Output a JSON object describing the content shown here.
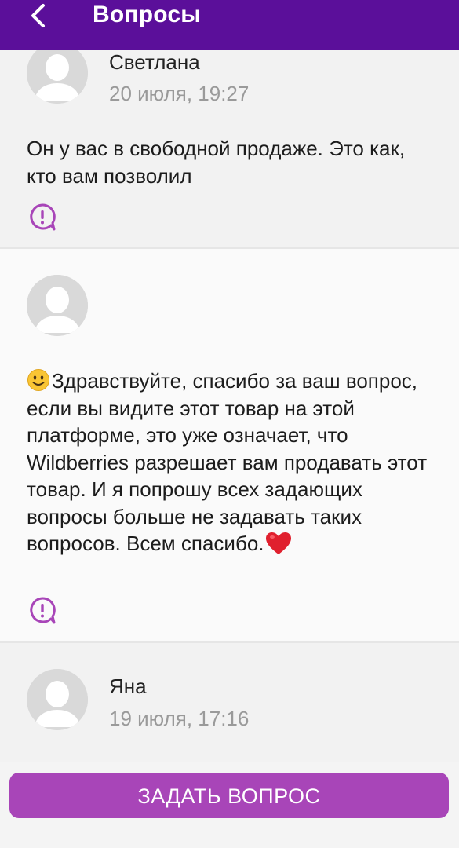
{
  "header": {
    "title": "Вопросы",
    "back_icon": "chevron-left-icon",
    "background": "#5b0f9a"
  },
  "questions": [
    {
      "author": "Светлана",
      "date": "20 июля, 19:27",
      "text": "Он у вас в свободной продаже. Это как, кто вам позволил",
      "report_icon": "report-icon"
    },
    {
      "author": "",
      "date": "",
      "text": "Здравствуйте, спасибо за ваш вопрос, если вы видите этот товар на этой платформе, это уже означает, что Wildberries разрешает вам продавать этот товар. И я попрошу всех задающих вопросы больше не задавать таких вопросов. Всем спасибо.",
      "leading_emoji": "slightly-smiling-face",
      "trailing_emoji": "red-heart",
      "report_icon": "report-icon"
    },
    {
      "author": "Яна",
      "date": "19 июля, 17:16"
    }
  ],
  "ask_button": {
    "label": "ЗАДАТЬ ВОПРОС",
    "color": "#a845b8"
  },
  "colors": {
    "accent": "#a845b8",
    "header": "#5b0f9a",
    "report_icon": "#a845b8"
  }
}
